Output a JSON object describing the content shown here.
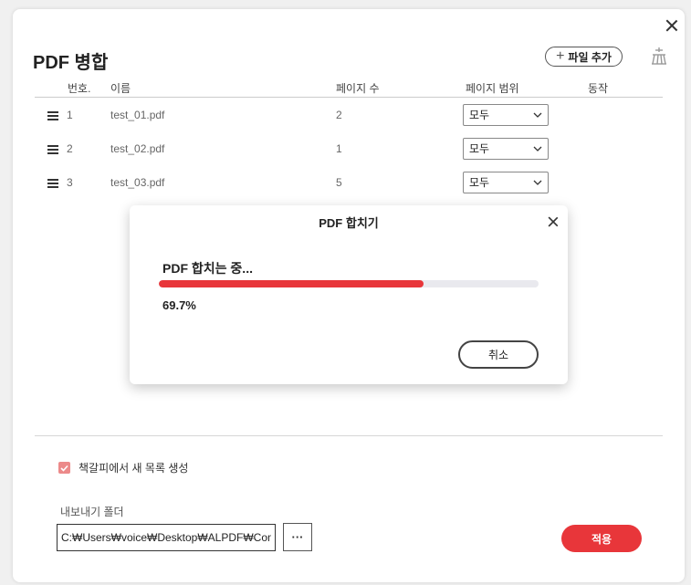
{
  "window": {
    "title": "PDF 병합",
    "add_file_label": "파일 추가",
    "columns": {
      "number": "번호.",
      "name": "이름",
      "pages": "페이지 수",
      "page_range": "페이지 범위",
      "action": "동작"
    },
    "files": [
      {
        "number": "1",
        "name": "test_01.pdf",
        "pages": "2",
        "range": "모두"
      },
      {
        "number": "2",
        "name": "test_02.pdf",
        "pages": "1",
        "range": "모두"
      },
      {
        "number": "3",
        "name": "test_03.pdf",
        "pages": "5",
        "range": "모두"
      }
    ],
    "bookmark_option": {
      "label": "책갈피에서 새 목록 생성",
      "checked": true
    },
    "export_folder_label": "내보내기 폴더",
    "export_path": "C:₩Users₩voice₩Desktop₩ALPDF₩Combine",
    "browse_label": "···",
    "apply_label": "적용"
  },
  "dialog": {
    "title": "PDF 합치기",
    "status": "PDF 합치는 중...",
    "progress": 0.697,
    "percent_text": "69.7%",
    "cancel_label": "취소"
  },
  "colors": {
    "accent": "#e8363a",
    "checkbox": "#ec8a8a",
    "progress_track": "#e9e9ee"
  },
  "icons": [
    "close-icon",
    "plus-icon",
    "clear-list-icon",
    "drag-handle-icon",
    "chevron-down-icon",
    "checkmark-icon"
  ]
}
